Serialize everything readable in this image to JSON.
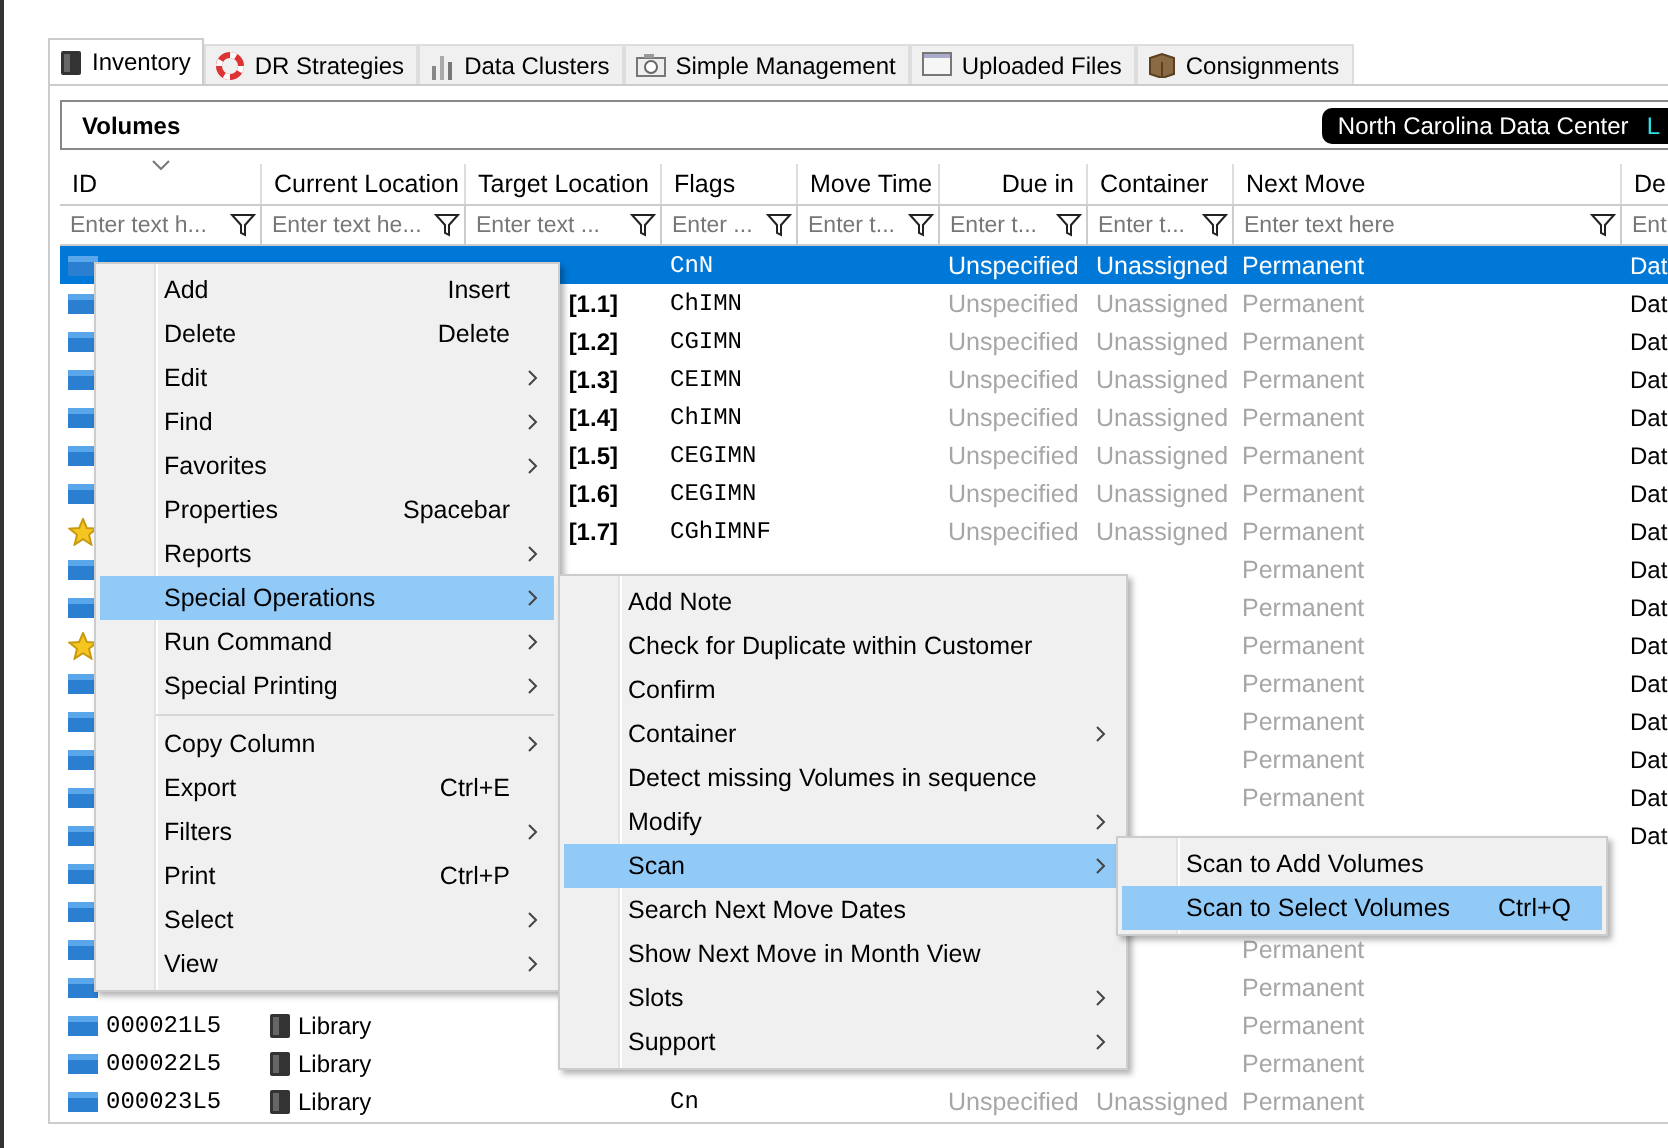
{
  "tabs": [
    {
      "label": "Inventory",
      "selected": true
    },
    {
      "label": "DR Strategies",
      "selected": false
    },
    {
      "label": "Data Clusters",
      "selected": false
    },
    {
      "label": "Simple Management",
      "selected": false
    },
    {
      "label": "Uploaded Files",
      "selected": false
    },
    {
      "label": "Consignments",
      "selected": false
    }
  ],
  "panel": {
    "title": "Volumes",
    "location_badge": "North Carolina Data Center",
    "badge_tail": "L"
  },
  "table": {
    "columns": [
      {
        "label": "ID",
        "placeholder": "Enter text h..."
      },
      {
        "label": "Current Location",
        "placeholder": "Enter text he..."
      },
      {
        "label": "Target Location",
        "placeholder": "Enter text ..."
      },
      {
        "label": "Flags",
        "placeholder": "Enter ..."
      },
      {
        "label": "Move Time",
        "placeholder": "Enter t..."
      },
      {
        "label": "Due in",
        "placeholder": "Enter t..."
      },
      {
        "label": "Container",
        "placeholder": "Enter t..."
      },
      {
        "label": "Next Move",
        "placeholder": "Enter text here"
      },
      {
        "label": "De",
        "placeholder": "Ent"
      }
    ],
    "rows": [
      {
        "kind": "tape",
        "selected": true,
        "flags": "CnN",
        "due_in": "Unspecified",
        "container": "Unassigned",
        "next_move": "Permanent",
        "column_9": "Dat"
      },
      {
        "kind": "tape",
        "selected": false,
        "target_location": "[1.1]",
        "flags": "ChIMN",
        "due_in": "Unspecified",
        "container": "Unassigned",
        "next_move": "Permanent",
        "column_9": "Dat"
      },
      {
        "kind": "tape",
        "selected": false,
        "target_location": "[1.2]",
        "flags": "CGIMN",
        "due_in": "Unspecified",
        "container": "Unassigned",
        "next_move": "Permanent",
        "column_9": "Dat"
      },
      {
        "kind": "tape",
        "selected": false,
        "target_location": "[1.3]",
        "flags": "CEIMN",
        "due_in": "Unspecified",
        "container": "Unassigned",
        "next_move": "Permanent",
        "column_9": "Dat"
      },
      {
        "kind": "tape",
        "selected": false,
        "target_location": "[1.4]",
        "flags": "ChIMN",
        "due_in": "Unspecified",
        "container": "Unassigned",
        "next_move": "Permanent",
        "column_9": "Dat"
      },
      {
        "kind": "tape",
        "selected": false,
        "target_location": "[1.5]",
        "flags": "CEGIMN",
        "due_in": "Unspecified",
        "container": "Unassigned",
        "next_move": "Permanent",
        "column_9": "Dat"
      },
      {
        "kind": "tape",
        "selected": false,
        "target_location": "[1.6]",
        "flags": "CEGIMN",
        "due_in": "Unspecified",
        "container": "Unassigned",
        "next_move": "Permanent",
        "column_9": "Dat"
      },
      {
        "kind": "star",
        "selected": false,
        "target_location": "[1.7]",
        "flags": "CGhIMNF",
        "due_in": "Unspecified",
        "container": "Unassigned",
        "next_move": "Permanent",
        "column_9": "Dat"
      },
      {
        "kind": "tape",
        "selected": false,
        "next_move": "Permanent",
        "column_9": "Dat"
      },
      {
        "kind": "tape",
        "selected": false,
        "next_move": "Permanent",
        "column_9": "Dat"
      },
      {
        "kind": "star",
        "selected": false,
        "next_move": "Permanent",
        "column_9": "Dat"
      },
      {
        "kind": "tape",
        "selected": false,
        "next_move": "Permanent",
        "column_9": "Dat"
      },
      {
        "kind": "tape",
        "selected": false,
        "next_move": "Permanent",
        "column_9": "Dat"
      },
      {
        "kind": "tape",
        "selected": false,
        "next_move": "Permanent",
        "column_9": "Dat"
      },
      {
        "kind": "tape",
        "selected": false,
        "next_move": "Permanent",
        "column_9": "Dat"
      },
      {
        "kind": "tape",
        "selected": false,
        "column_9": "Dat"
      },
      {
        "kind": "tape",
        "selected": false
      },
      {
        "kind": "tape",
        "selected": false
      },
      {
        "kind": "tape",
        "selected": false,
        "next_move": "Permanent"
      },
      {
        "kind": "tape",
        "selected": false,
        "next_move": "Permanent"
      },
      {
        "kind": "tape",
        "selected": false,
        "id": "000021L5",
        "current_location": "Library",
        "next_move": "Permanent"
      },
      {
        "kind": "tape",
        "selected": false,
        "id": "000022L5",
        "current_location": "Library",
        "next_move": "Permanent"
      },
      {
        "kind": "tape",
        "selected": false,
        "id": "000023L5",
        "current_location": "Library",
        "flags": "Cn",
        "due_in": "Unspecified",
        "container": "Unassigned",
        "next_move": "Permanent"
      }
    ]
  },
  "context_menu": {
    "groups": [
      [
        {
          "label": "Add",
          "shortcut": "Insert",
          "submenu": false,
          "selected": false
        },
        {
          "label": "Delete",
          "shortcut": "Delete",
          "submenu": false,
          "selected": false
        },
        {
          "label": "Edit",
          "submenu": true,
          "selected": false
        },
        {
          "label": "Find",
          "submenu": true,
          "selected": false
        },
        {
          "label": "Favorites",
          "submenu": true,
          "selected": false
        },
        {
          "label": "Properties",
          "shortcut": "Spacebar",
          "submenu": false,
          "selected": false
        },
        {
          "label": "Reports",
          "submenu": true,
          "selected": false
        },
        {
          "label": "Special Operations",
          "submenu": true,
          "selected": true
        },
        {
          "label": "Run Command",
          "submenu": true,
          "selected": false
        },
        {
          "label": "Special Printing",
          "submenu": true,
          "selected": false
        }
      ],
      [
        {
          "label": "Copy Column",
          "submenu": true,
          "selected": false
        },
        {
          "label": "Export",
          "shortcut": "Ctrl+E",
          "submenu": false,
          "selected": false
        },
        {
          "label": "Filters",
          "submenu": true,
          "selected": false
        },
        {
          "label": "Print",
          "shortcut": "Ctrl+P",
          "submenu": false,
          "selected": false
        },
        {
          "label": "Select",
          "submenu": true,
          "selected": false
        },
        {
          "label": "View",
          "submenu": true,
          "selected": false
        }
      ]
    ]
  },
  "special_operations_menu": {
    "items": [
      {
        "label": "Add Note",
        "submenu": false,
        "selected": false
      },
      {
        "label": "Check for Duplicate within Customer",
        "submenu": false,
        "selected": false
      },
      {
        "label": "Confirm",
        "submenu": false,
        "selected": false
      },
      {
        "label": "Container",
        "submenu": true,
        "selected": false
      },
      {
        "label": "Detect missing Volumes in sequence",
        "submenu": false,
        "selected": false
      },
      {
        "label": "Modify",
        "submenu": true,
        "selected": false
      },
      {
        "label": "Scan",
        "submenu": true,
        "selected": true
      },
      {
        "label": "Search Next Move Dates",
        "submenu": false,
        "selected": false
      },
      {
        "label": "Show Next Move in Month View",
        "submenu": false,
        "selected": false
      },
      {
        "label": "Slots",
        "submenu": true,
        "selected": false
      },
      {
        "label": "Support",
        "submenu": true,
        "selected": false
      }
    ]
  },
  "scan_menu": {
    "items": [
      {
        "label": "Scan to Add Volumes",
        "submenu": false,
        "selected": false
      },
      {
        "label": "Scan to Select Volumes",
        "shortcut": "Ctrl+Q",
        "submenu": false,
        "selected": true
      }
    ]
  }
}
